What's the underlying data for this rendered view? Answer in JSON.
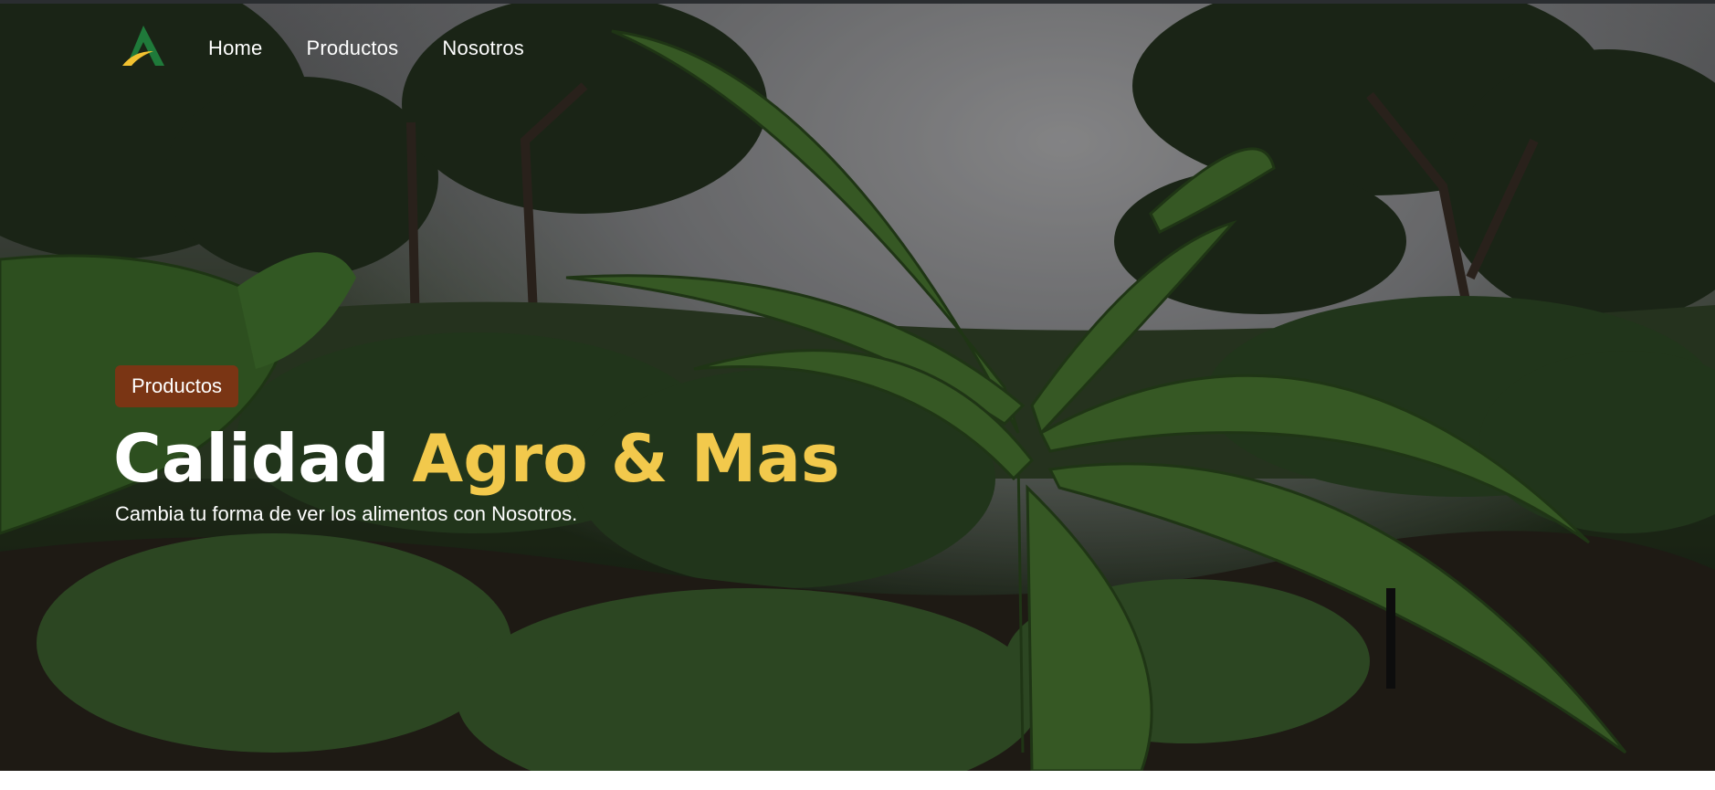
{
  "nav": {
    "logo_icon": "agro-mountain-logo-icon",
    "links": [
      "Home",
      "Productos",
      "Nosotros"
    ]
  },
  "hero": {
    "badge": "Productos",
    "title_white": "Calidad",
    "title_yellow": "Agro & Mas",
    "subtitle": "Cambia tu forma de ver los alimentos con Nosotros."
  },
  "colors": {
    "badge_bg": "#7a3514",
    "title_accent": "#f2c94c",
    "logo_green": "#1f7a3a",
    "logo_yellow": "#f2c230"
  }
}
